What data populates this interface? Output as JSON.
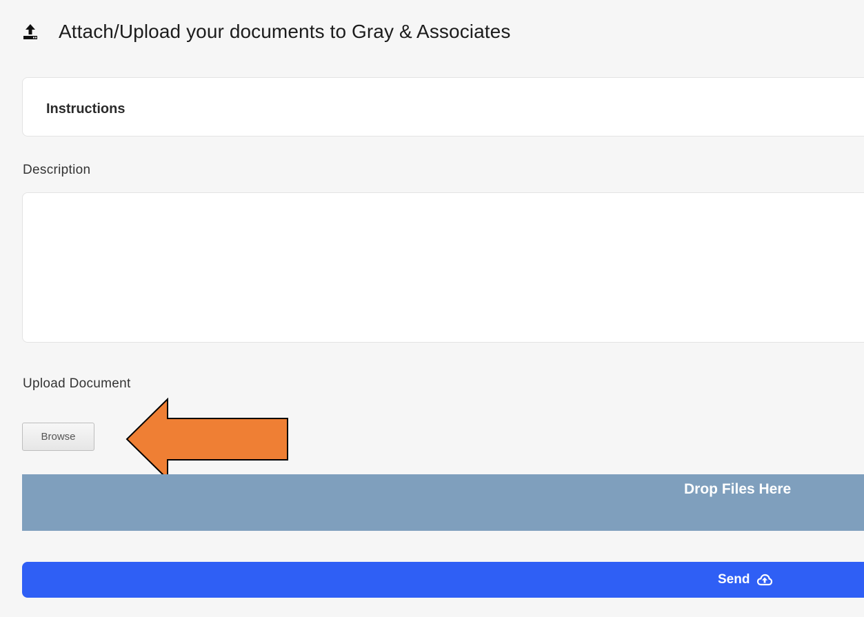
{
  "header": {
    "title": "Attach/Upload your documents to Gray & Associates",
    "icon": "upload-icon"
  },
  "instructions": {
    "label": "Instructions"
  },
  "description": {
    "label": "Description",
    "value": "",
    "placeholder": ""
  },
  "upload": {
    "label": "Upload Document",
    "browse_label": "Browse",
    "drop_zone_text": "Drop Files Here"
  },
  "send": {
    "label": "Send",
    "icon": "cloud-upload-icon"
  },
  "annotation": {
    "icon": "arrow-left-icon",
    "color": "#ef7f34"
  },
  "colors": {
    "background": "#f6f6f6",
    "drop_zone": "#7f9fbd",
    "send_button": "#2f5ff5",
    "arrow": "#ef7f34"
  }
}
